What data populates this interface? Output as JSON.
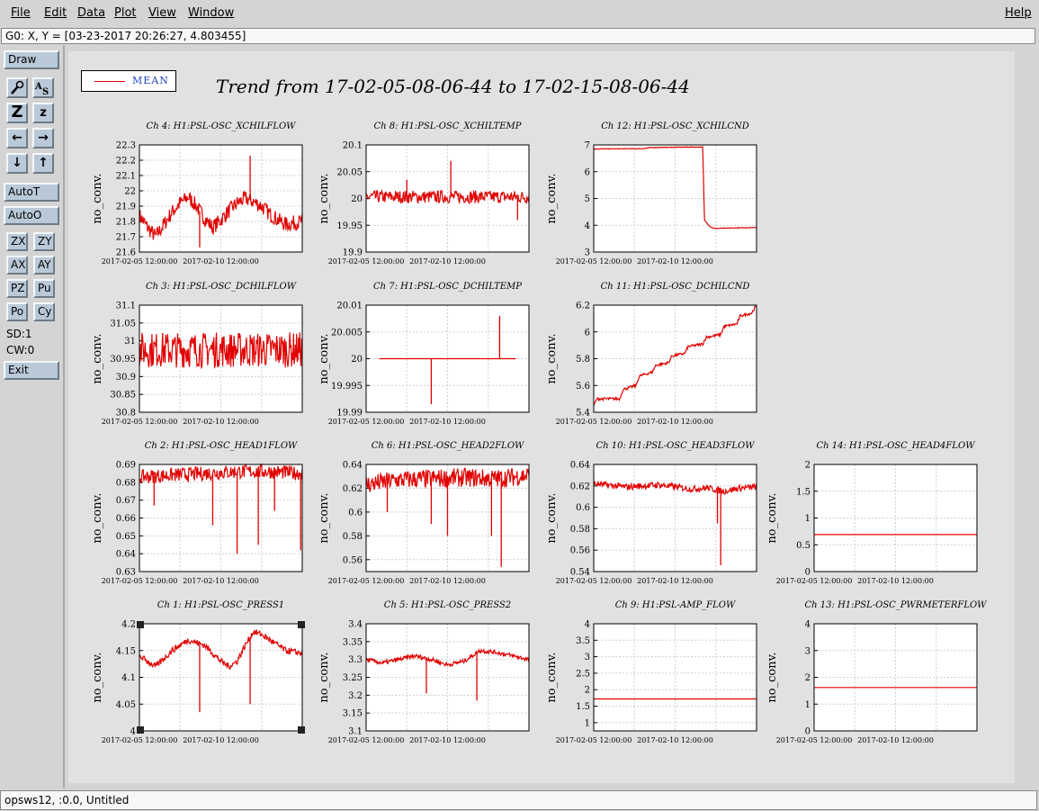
{
  "menu": [
    {
      "id": "file",
      "label": "File"
    },
    {
      "id": "edit",
      "label": "Edit"
    },
    {
      "id": "data",
      "label": "Data"
    },
    {
      "id": "plot",
      "label": "Plot"
    },
    {
      "id": "view",
      "label": "View"
    },
    {
      "id": "window",
      "label": "Window"
    }
  ],
  "help_label": "Help",
  "coord_readout": "G0: X, Y = [03-23-2017 20:26:27, 4.803455]",
  "toolbar": {
    "draw": "Draw",
    "icons": [
      "magnify-icon",
      "text-size-icon",
      "zoom-large-icon",
      "zoom-small-icon",
      "arrow-left-icon",
      "arrow-right-icon",
      "arrow-down-icon",
      "arrow-up-icon"
    ],
    "autot": "AutoT",
    "autoo": "AutoO",
    "zx": "ZX",
    "zy": "ZY",
    "ax": "AX",
    "ay": "AY",
    "pz": "PZ",
    "pu": "Pu",
    "po": "Po",
    "cy": "Cy",
    "sd": "SD:1",
    "cw": "CW:0",
    "exit": "Exit"
  },
  "legend": {
    "label": "MEAN",
    "color": "#e00000"
  },
  "title": "Trend from 17-02-05-08-06-44 to 17-02-15-08-06-44",
  "status": "opsws12, :0.0, Untitled",
  "chart_data": [
    {
      "type": "line",
      "title": "Ch 4: H1:PSL-OSC_XCHILFLOW",
      "ylabel": "no_conv.",
      "ylim": [
        21.6,
        22.3
      ],
      "yticks": [
        "21.6",
        "21.7",
        "21.8",
        "21.9",
        "22",
        "22.1",
        "22.2",
        "22.3"
      ],
      "xticks": [
        "2017-02-05 12:00:00",
        "2017-02-10 12:00:00"
      ],
      "series": [
        {
          "x": [
            0,
            0.05,
            0.1,
            0.15,
            0.2,
            0.25,
            0.3,
            0.35,
            0.4,
            0.45,
            0.5,
            0.55,
            0.6,
            0.65,
            0.7,
            0.75,
            0.8,
            0.85,
            0.9,
            0.95,
            1
          ],
          "y": [
            21.84,
            21.76,
            21.7,
            21.78,
            21.86,
            21.92,
            21.96,
            21.9,
            21.82,
            21.76,
            21.81,
            21.87,
            21.92,
            21.95,
            21.93,
            21.9,
            21.85,
            21.81,
            21.78,
            21.79,
            21.8
          ],
          "noise": 0.05,
          "spikes": [
            {
              "x": 0.37,
              "y": 21.63
            },
            {
              "x": 0.68,
              "y": 22.23
            }
          ]
        }
      ]
    },
    {
      "type": "line",
      "title": "Ch 8: H1:PSL-OSC_XCHILTEMP",
      "ylabel": "no_conv.",
      "ylim": [
        19.9,
        20.1
      ],
      "yticks": [
        "19.9",
        "19.95",
        "20",
        "20.05",
        "20.1"
      ],
      "xticks": [
        "2017-02-05 12:00:00",
        "2017-02-10 12:00:00"
      ],
      "series": [
        {
          "x": [
            0,
            1
          ],
          "y": [
            20.003,
            20.003
          ],
          "noise": 0.012,
          "spikes": [
            {
              "x": 0.25,
              "y": 20.035
            },
            {
              "x": 0.52,
              "y": 20.07
            },
            {
              "x": 0.93,
              "y": 19.96
            }
          ]
        }
      ]
    },
    {
      "type": "line",
      "title": "Ch 12: H1:PSL-OSC_XCHILCND",
      "ylabel": "no_conv.",
      "ylim": [
        3,
        7
      ],
      "yticks": [
        "3",
        "4",
        "5",
        "6",
        "7"
      ],
      "xticks": [
        "2017-02-05 12:00:00",
        "2017-02-10 12:00:00"
      ],
      "series": [
        {
          "x": [
            0,
            0.3,
            0.35,
            0.6,
            0.67,
            0.68,
            0.7,
            0.72,
            0.75,
            1
          ],
          "y": [
            6.85,
            6.86,
            6.9,
            6.92,
            6.92,
            4.2,
            4.05,
            3.92,
            3.88,
            3.92
          ],
          "noise": 0.01,
          "spikes": []
        }
      ]
    },
    null,
    {
      "type": "line",
      "title": "Ch 3: H1:PSL-OSC_DCHILFLOW",
      "ylabel": "no_conv.",
      "ylim": [
        30.8,
        31.1
      ],
      "yticks": [
        "30.8",
        "30.85",
        "30.9",
        "30.95",
        "31",
        "31.05",
        "31.1"
      ],
      "xticks": [
        "2017-02-05 12:00:00",
        "2017-02-10 12:00:00"
      ],
      "series": [
        {
          "x": [
            0,
            1
          ],
          "y": [
            30.975,
            30.975
          ],
          "noise": 0.05,
          "spikes": []
        }
      ]
    },
    {
      "type": "line",
      "title": "Ch 7: H1:PSL-OSC_DCHILTEMP",
      "ylabel": "no_conv.",
      "ylim": [
        19.99,
        20.01
      ],
      "yticks": [
        "19.99",
        "19.995",
        "20",
        "20.005",
        "20.01"
      ],
      "xticks": [
        "2017-02-05 12:00:00",
        "2017-02-10 12:00:00"
      ],
      "series": [
        {
          "x": [
            0.08,
            0.92
          ],
          "y": [
            20,
            20
          ],
          "noise": 0,
          "spikes": [
            {
              "x": 0.4,
              "y": 19.9915
            },
            {
              "x": 0.82,
              "y": 20.008
            }
          ]
        }
      ]
    },
    {
      "type": "line",
      "title": "Ch 11: H1:PSL-OSC_DCHILCND",
      "ylabel": "no_conv.",
      "ylim": [
        5.4,
        6.2
      ],
      "yticks": [
        "5.4",
        "5.6",
        "5.8",
        "6",
        "6.2"
      ],
      "xticks": [
        "2017-02-05 12:00:00",
        "2017-02-10 12:00:00"
      ],
      "series": [
        {
          "x": [
            0,
            0.02,
            0.16,
            0.18,
            0.26,
            0.28,
            0.36,
            0.38,
            0.46,
            0.48,
            0.56,
            0.58,
            0.67,
            0.69,
            0.78,
            0.8,
            0.88,
            0.9,
            0.97,
            1
          ],
          "y": [
            5.45,
            5.5,
            5.5,
            5.57,
            5.6,
            5.67,
            5.7,
            5.75,
            5.77,
            5.82,
            5.84,
            5.89,
            5.91,
            5.96,
            5.98,
            6.04,
            6.06,
            6.12,
            6.14,
            6.2
          ],
          "noise": 0.01,
          "spikes": []
        }
      ]
    },
    null,
    {
      "type": "line",
      "title": "Ch 2: H1:PSL-OSC_HEAD1FLOW",
      "ylabel": "no_conv.",
      "ylim": [
        0.63,
        0.69
      ],
      "yticks": [
        "0.63",
        "0.64",
        "0.65",
        "0.66",
        "0.67",
        "0.68",
        "0.69"
      ],
      "xticks": [
        "2017-02-05 12:00:00",
        "2017-02-10 12:00:00"
      ],
      "series": [
        {
          "x": [
            0,
            0.2,
            0.4,
            0.6,
            0.8,
            1
          ],
          "y": [
            0.683,
            0.684,
            0.685,
            0.686,
            0.686,
            0.685
          ],
          "noise": 0.004,
          "spikes": [
            {
              "x": 0.09,
              "y": 0.667
            },
            {
              "x": 0.45,
              "y": 0.656
            },
            {
              "x": 0.6,
              "y": 0.64
            },
            {
              "x": 0.73,
              "y": 0.645
            },
            {
              "x": 0.83,
              "y": 0.664
            },
            {
              "x": 0.99,
              "y": 0.642
            }
          ]
        }
      ]
    },
    {
      "type": "line",
      "title": "Ch 6: H1:PSL-OSC_HEAD2FLOW",
      "ylabel": "no_conv.",
      "ylim": [
        0.55,
        0.64
      ],
      "yticks": [
        "0.56",
        "0.58",
        "0.6",
        "0.62",
        "0.64"
      ],
      "xticks": [
        "2017-02-05 12:00:00",
        "2017-02-10 12:00:00"
      ],
      "series": [
        {
          "x": [
            0,
            0.2,
            0.4,
            0.6,
            0.8,
            1
          ],
          "y": [
            0.623,
            0.627,
            0.628,
            0.629,
            0.628,
            0.631
          ],
          "noise": 0.008,
          "spikes": [
            {
              "x": 0.13,
              "y": 0.6
            },
            {
              "x": 0.4,
              "y": 0.59
            },
            {
              "x": 0.5,
              "y": 0.58
            },
            {
              "x": 0.77,
              "y": 0.58
            },
            {
              "x": 0.83,
              "y": 0.554
            }
          ]
        }
      ]
    },
    {
      "type": "line",
      "title": "Ch 10: H1:PSL-OSC_HEAD3FLOW",
      "ylabel": "no_conv.",
      "ylim": [
        0.54,
        0.64
      ],
      "yticks": [
        "0.54",
        "0.56",
        "0.58",
        "0.6",
        "0.62",
        "0.64"
      ],
      "xticks": [
        "2017-02-05 12:00:00",
        "2017-02-10 12:00:00"
      ],
      "series": [
        {
          "x": [
            0,
            0.2,
            0.4,
            0.6,
            0.7,
            0.8,
            0.9,
            1
          ],
          "y": [
            0.622,
            0.619,
            0.621,
            0.617,
            0.618,
            0.615,
            0.618,
            0.619
          ],
          "noise": 0.003,
          "spikes": [
            {
              "x": 0.78,
              "y": 0.546
            },
            {
              "x": 0.76,
              "y": 0.585
            }
          ]
        }
      ]
    },
    {
      "type": "line",
      "title": "Ch 14: H1:PSL-OSC_HEAD4FLOW",
      "ylabel": "no_conv.",
      "ylim": [
        0,
        2
      ],
      "yticks": [
        "0",
        "0.5",
        "1",
        "1.5",
        "2"
      ],
      "xticks": [
        "2017-02-05 12:00:00",
        "2017-02-10 12:00:00"
      ],
      "series": [
        {
          "x": [
            0,
            1
          ],
          "y": [
            0.69,
            0.69
          ],
          "noise": 0,
          "spikes": []
        }
      ]
    },
    {
      "type": "line",
      "title": "Ch 1: H1:PSL-OSC_PRESS1",
      "ylabel": "no_conv.",
      "ylim": [
        4,
        4.2
      ],
      "yticks": [
        "4",
        "4.05",
        "4.1",
        "4.15",
        "4.2"
      ],
      "xticks": [
        "2017-02-05 12:00:00",
        "2017-02-10 12:00:00"
      ],
      "series": [
        {
          "x": [
            0,
            0.1,
            0.2,
            0.3,
            0.4,
            0.5,
            0.55,
            0.6,
            0.65,
            0.7,
            0.75,
            0.8,
            0.85,
            0.9,
            1
          ],
          "y": [
            4.14,
            4.12,
            4.15,
            4.17,
            4.16,
            4.13,
            4.12,
            4.13,
            4.16,
            4.185,
            4.18,
            4.17,
            4.16,
            4.15,
            4.145
          ],
          "noise": 0.006,
          "spikes": [
            {
              "x": 0.37,
              "y": 4.035
            },
            {
              "x": 0.68,
              "y": 4.05
            }
          ]
        }
      ]
    },
    {
      "type": "line",
      "title": "Ch 5: H1:PSL-OSC_PRESS2",
      "ylabel": "no_conv.",
      "ylim": [
        3.1,
        3.4
      ],
      "yticks": [
        "3.1",
        "3.15",
        "3.2",
        "3.25",
        "3.3",
        "3.35",
        "3.4"
      ],
      "xticks": [
        "2017-02-05 12:00:00",
        "2017-02-10 12:00:00"
      ],
      "series": [
        {
          "x": [
            0,
            0.1,
            0.2,
            0.3,
            0.4,
            0.5,
            0.6,
            0.65,
            0.7,
            0.8,
            0.9,
            1
          ],
          "y": [
            3.3,
            3.29,
            3.3,
            3.31,
            3.3,
            3.285,
            3.295,
            3.31,
            3.325,
            3.32,
            3.31,
            3.3
          ],
          "noise": 0.006,
          "spikes": [
            {
              "x": 0.37,
              "y": 3.205
            },
            {
              "x": 0.68,
              "y": 3.185
            }
          ]
        }
      ]
    },
    {
      "type": "line",
      "title": "Ch 9: H1:PSL-AMP_FLOW",
      "ylabel": "no_conv.",
      "ylim": [
        0.75,
        4
      ],
      "yticks": [
        "1",
        "1.5",
        "2",
        "2.5",
        "3",
        "3.5",
        "4"
      ],
      "xticks": [
        "2017-02-05 12:00:00",
        "2017-02-10 12:00:00"
      ],
      "series": [
        {
          "x": [
            0,
            1
          ],
          "y": [
            1.72,
            1.72
          ],
          "noise": 0,
          "spikes": []
        }
      ]
    },
    {
      "type": "line",
      "title": "Ch 13: H1:PSL-OSC_PWRMETERFLOW",
      "ylabel": "no_conv.",
      "ylim": [
        0,
        4
      ],
      "yticks": [
        "0",
        "1",
        "2",
        "3",
        "4"
      ],
      "xticks": [
        "2017-02-05 12:00:00",
        "2017-02-10 12:00:00"
      ],
      "series": [
        {
          "x": [
            0,
            1
          ],
          "y": [
            1.62,
            1.62
          ],
          "noise": 0,
          "spikes": []
        }
      ]
    }
  ]
}
